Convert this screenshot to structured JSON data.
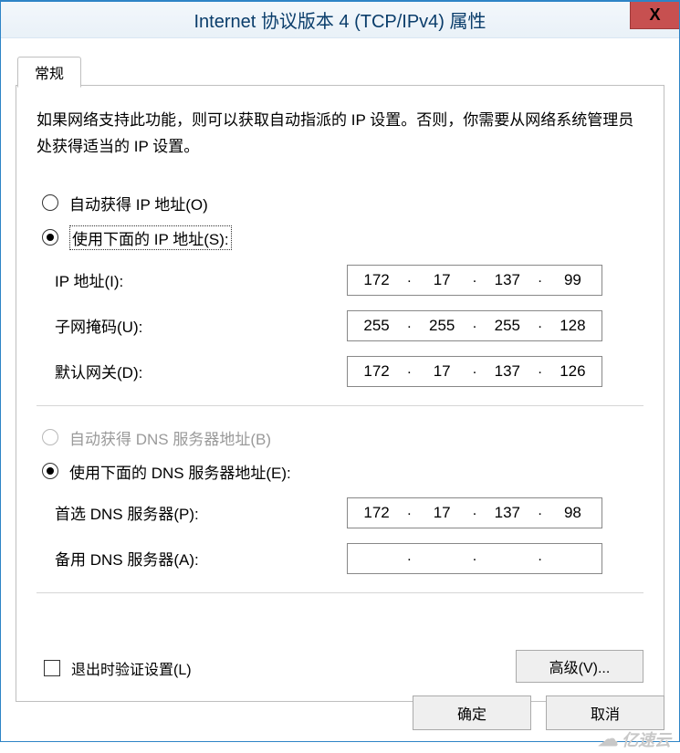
{
  "window": {
    "title": "Internet 协议版本 4 (TCP/IPv4) 属性",
    "close_label": "X"
  },
  "tabs": {
    "general": "常规"
  },
  "intro": "如果网络支持此功能，则可以获取自动指派的 IP 设置。否则，你需要从网络系统管理员处获得适当的 IP 设置。",
  "ip_group": {
    "auto_label": "自动获得 IP 地址(O)",
    "manual_label": "使用下面的 IP 地址(S):",
    "selected": "manual",
    "fields": {
      "ip_label": "IP 地址(I):",
      "ip": [
        "172",
        "17",
        "137",
        "99"
      ],
      "mask_label": "子网掩码(U):",
      "mask": [
        "255",
        "255",
        "255",
        "128"
      ],
      "gw_label": "默认网关(D):",
      "gw": [
        "172",
        "17",
        "137",
        "126"
      ]
    }
  },
  "dns_group": {
    "auto_label": "自动获得 DNS 服务器地址(B)",
    "auto_enabled": false,
    "manual_label": "使用下面的 DNS 服务器地址(E):",
    "selected": "manual",
    "fields": {
      "primary_label": "首选 DNS 服务器(P):",
      "primary": [
        "172",
        "17",
        "137",
        "98"
      ],
      "alt_label": "备用 DNS 服务器(A):",
      "alt": [
        "",
        "",
        "",
        ""
      ]
    }
  },
  "validate_checkbox": {
    "label": "退出时验证设置(L)",
    "checked": false
  },
  "buttons": {
    "advanced": "高级(V)...",
    "ok": "确定",
    "cancel": "取消"
  },
  "watermark": "亿速云"
}
